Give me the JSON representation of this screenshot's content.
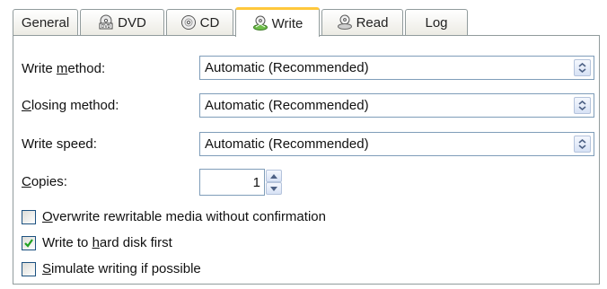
{
  "tabs": [
    {
      "label": "General",
      "icon": "none"
    },
    {
      "label": "DVD",
      "icon": "dvd-icon"
    },
    {
      "label": "CD",
      "icon": "cd-icon"
    },
    {
      "label": "Write",
      "icon": "write-disc-icon"
    },
    {
      "label": "Read",
      "icon": "read-disc-icon"
    },
    {
      "label": "Log",
      "icon": "none"
    }
  ],
  "active_tab": "Write",
  "write_method": {
    "label_pre": "Write ",
    "label_ul": "m",
    "label_post": "ethod:",
    "value": "Automatic (Recommended)"
  },
  "closing_method": {
    "label_pre": "",
    "label_ul": "C",
    "label_post": "losing method:",
    "value": "Automatic (Recommended)"
  },
  "write_speed": {
    "label_pre": "Write speed:",
    "label_ul": "",
    "label_post": "",
    "value": "Automatic (Recommended)"
  },
  "copies": {
    "label_pre": "",
    "label_ul": "C",
    "label_post": "opies:",
    "value": "1"
  },
  "options": {
    "overwrite": {
      "label_pre": "",
      "label_ul": "O",
      "label_post": "verwrite rewritable media without confirmation",
      "checked": false
    },
    "hard_disk": {
      "label_pre": "Write to ",
      "label_ul": "h",
      "label_post": "ard disk first",
      "checked": true
    },
    "simulate": {
      "label_pre": "",
      "label_ul": "S",
      "label_post": "imulate writing if possible",
      "checked": false
    }
  },
  "colors": {
    "active_tab_accent": "#ffc83c",
    "border": "#919b9c",
    "input_border": "#7f9db9",
    "check": "#21a121"
  }
}
